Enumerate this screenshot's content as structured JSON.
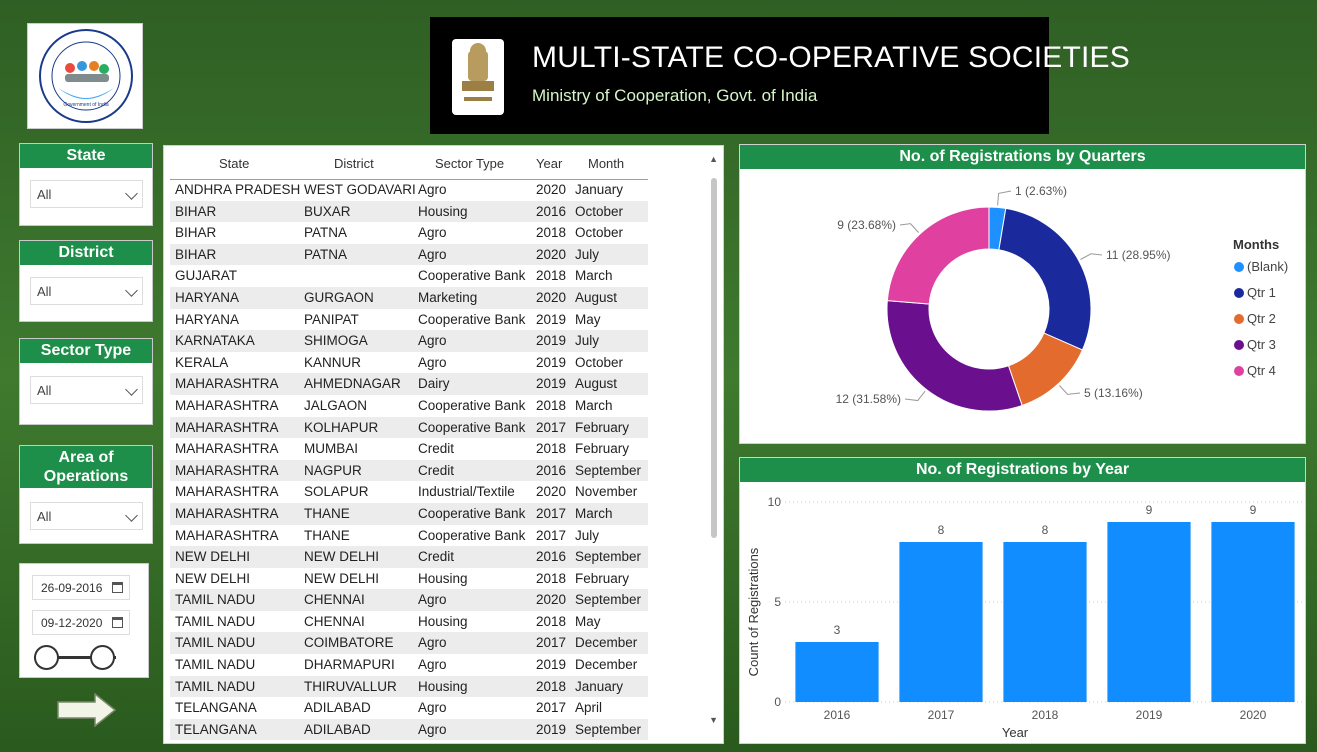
{
  "banner": {
    "title": "MULTI-STATE CO-OPERATIVE SOCIETIES",
    "subtitle": "Ministry of Cooperation, Govt. of India"
  },
  "logo": {
    "ring_text": "Multi State Cooperative Societies (MSCS)",
    "footer_text": "Government of India"
  },
  "slicers": {
    "state": {
      "label": "State",
      "value": "All"
    },
    "district": {
      "label": "District",
      "value": "All"
    },
    "sector_type": {
      "label": "Sector Type",
      "value": "All"
    },
    "area_of_operations": {
      "label": "Area of Operations",
      "value": "All"
    }
  },
  "date_range": {
    "start": "26-09-2016",
    "end": "09-12-2020"
  },
  "table": {
    "columns": [
      "State",
      "District",
      "Sector Type",
      "Year",
      "Month"
    ],
    "rows": [
      [
        "ANDHRA PRADESH",
        "WEST GODAVARI",
        "Agro",
        "2020",
        "January"
      ],
      [
        "BIHAR",
        "BUXAR",
        "Housing",
        "2016",
        "October"
      ],
      [
        "BIHAR",
        "PATNA",
        "Agro",
        "2018",
        "October"
      ],
      [
        "BIHAR",
        "PATNA",
        "Agro",
        "2020",
        "July"
      ],
      [
        "GUJARAT",
        "",
        "Cooperative Bank",
        "2018",
        "March"
      ],
      [
        "HARYANA",
        "GURGAON",
        "Marketing",
        "2020",
        "August"
      ],
      [
        "HARYANA",
        "PANIPAT",
        "Cooperative Bank",
        "2019",
        "May"
      ],
      [
        "KARNATAKA",
        "SHIMOGA",
        "Agro",
        "2019",
        "July"
      ],
      [
        "KERALA",
        "KANNUR",
        "Agro",
        "2019",
        "October"
      ],
      [
        "MAHARASHTRA",
        "AHMEDNAGAR",
        "Dairy",
        "2019",
        "August"
      ],
      [
        "MAHARASHTRA",
        "JALGAON",
        "Cooperative Bank",
        "2018",
        "March"
      ],
      [
        "MAHARASHTRA",
        "KOLHAPUR",
        "Cooperative Bank",
        "2017",
        "February"
      ],
      [
        "MAHARASHTRA",
        "MUMBAI",
        "Credit",
        "2018",
        "February"
      ],
      [
        "MAHARASHTRA",
        "NAGPUR",
        "Credit",
        "2016",
        "September"
      ],
      [
        "MAHARASHTRA",
        "SOLAPUR",
        "Industrial/Textile",
        "2020",
        "November"
      ],
      [
        "MAHARASHTRA",
        "THANE",
        "Cooperative Bank",
        "2017",
        "March"
      ],
      [
        "MAHARASHTRA",
        "THANE",
        "Cooperative Bank",
        "2017",
        "July"
      ],
      [
        "NEW DELHI",
        "NEW DELHI",
        "Credit",
        "2016",
        "September"
      ],
      [
        "NEW DELHI",
        "NEW DELHI",
        "Housing",
        "2018",
        "February"
      ],
      [
        "TAMIL NADU",
        "CHENNAI",
        "Agro",
        "2020",
        "September"
      ],
      [
        "TAMIL NADU",
        "CHENNAI",
        "Housing",
        "2018",
        "May"
      ],
      [
        "TAMIL NADU",
        "COIMBATORE",
        "Agro",
        "2017",
        "December"
      ],
      [
        "TAMIL NADU",
        "DHARMAPURI",
        "Agro",
        "2019",
        "December"
      ],
      [
        "TAMIL NADU",
        "THIRUVALLUR",
        "Housing",
        "2018",
        "January"
      ],
      [
        "TELANGANA",
        "ADILABAD",
        "Agro",
        "2017",
        "April"
      ],
      [
        "TELANGANA",
        "ADILABAD",
        "Agro",
        "2019",
        "September"
      ]
    ]
  },
  "chart_data": [
    {
      "type": "pie",
      "title": "No. of Registrations by Quarters",
      "legend_title": "Months",
      "legend_position": "right",
      "categories": [
        "(Blank)",
        "Qtr 1",
        "Qtr 2",
        "Qtr 3",
        "Qtr 4"
      ],
      "values": [
        1,
        11,
        5,
        12,
        9
      ],
      "data_labels": [
        "1 (2.63%)",
        "11 (28.95%)",
        "5 (13.16%)",
        "12 (31.58%)",
        "9 (23.68%)"
      ],
      "colors": [
        "#1e90ff",
        "#1a2a9c",
        "#e46b2e",
        "#6a0f8e",
        "#e040a0"
      ]
    },
    {
      "type": "bar",
      "title": "No. of Registrations by Year",
      "categories": [
        "2016",
        "2017",
        "2018",
        "2019",
        "2020"
      ],
      "values": [
        3,
        8,
        8,
        9,
        9
      ],
      "xlabel": "Year",
      "ylabel": "Count of Registrations",
      "ylim": [
        0,
        10
      ],
      "yticks": [
        "0",
        "5",
        "10"
      ],
      "grid": true,
      "color": "#118dff"
    }
  ]
}
